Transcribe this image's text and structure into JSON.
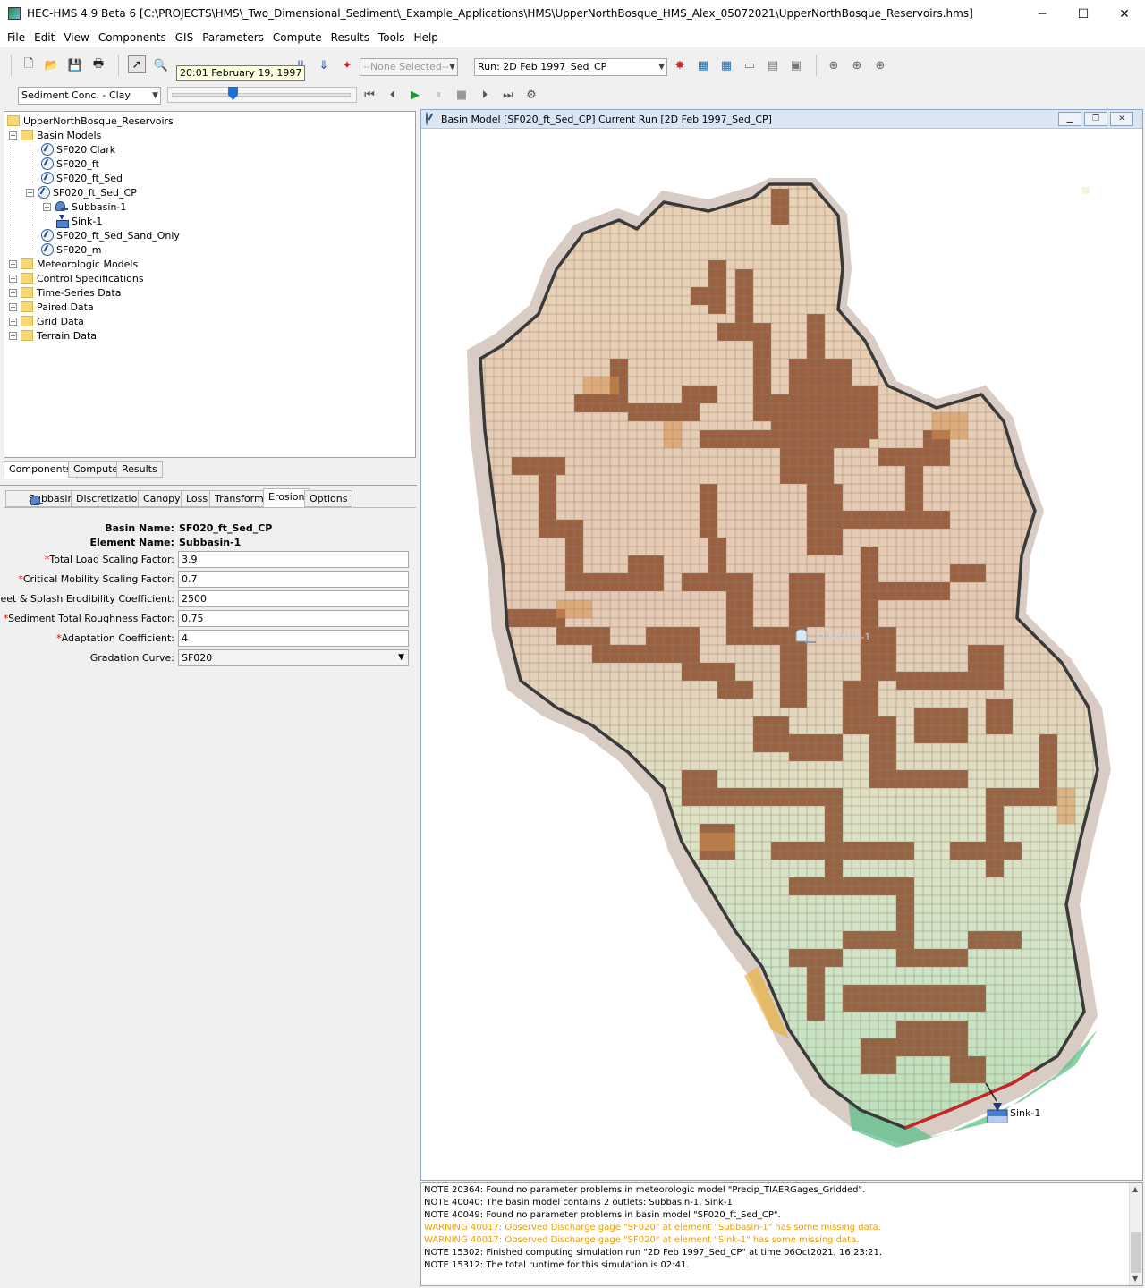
{
  "window": {
    "title": "HEC-HMS 4.9 Beta 6 [C:\\PROJECTS\\HMS\\_Two_Dimensional_Sediment\\_Example_Applications\\HMS\\UpperNorthBosque_HMS_Alex_05072021\\UpperNorthBosque_Reservoirs.hms]",
    "minimize": "─",
    "maximize": "☐",
    "close": "✕"
  },
  "menu": [
    "File",
    "Edit",
    "View",
    "Components",
    "GIS",
    "Parameters",
    "Compute",
    "Results",
    "Tools",
    "Help"
  ],
  "toolbar": {
    "tooltip": "20:01 February 19, 1997",
    "element_selector": "--None Selected--",
    "run_selector": "Run: 2D Feb 1997_Sed_CP",
    "variable_selector": "Sediment Conc. - Clay",
    "animation_position": 0.34
  },
  "tree": {
    "root": "UpperNorthBosque_Reservoirs",
    "basin_models_label": "Basin Models",
    "basins": [
      "SF020 Clark",
      "SF020_ft",
      "SF020_ft_Sed",
      "SF020_ft_Sed_CP"
    ],
    "children": [
      "Subbasin-1",
      "Sink-1"
    ],
    "basins_after": [
      "SF020_ft_Sed_Sand_Only",
      "SF020_m"
    ],
    "folders": [
      "Meteorologic Models",
      "Control Specifications",
      "Time-Series Data",
      "Paired Data",
      "Grid Data",
      "Terrain Data"
    ]
  },
  "bottom_tabs": [
    "Components",
    "Compute",
    "Results"
  ],
  "prop_tabs": [
    "Subbasin",
    "Discretization",
    "Canopy",
    "Loss",
    "Transform",
    "Erosion",
    "Options"
  ],
  "properties": {
    "basin_name_label": "Basin Name:",
    "basin_name": "SF020_ft_Sed_CP",
    "element_name_label": "Element Name:",
    "element_name": "Subbasin-1",
    "fields": [
      {
        "label": "Total Load Scaling Factor:",
        "value": "3.9",
        "required": "*"
      },
      {
        "label": "Critical Mobility Scaling Factor:",
        "value": "0.7",
        "required": "*"
      },
      {
        "label": "Sheet & Splash Erodibility Coefficient:",
        "value": "2500",
        "required": "*"
      },
      {
        "label": "Sediment Total Roughness Factor:",
        "value": "0.75",
        "required": "*"
      },
      {
        "label": "Adaptation Coefficient:",
        "value": "4",
        "required": "*"
      }
    ],
    "gradation_label": "Gradation Curve:",
    "gradation_value": "SF020"
  },
  "map": {
    "title": "Basin Model [SF020_ft_Sed_CP] Current Run [2D Feb 1997_Sed_CP]",
    "subbasin_label": "Subbasin-1",
    "sink_label": "Sink-1"
  },
  "log": [
    {
      "text": "NOTE 20364:  Found no parameter problems in meteorologic model \"Precip_TIAERGages_Gridded\".",
      "level": "note"
    },
    {
      "text": "NOTE 40040:  The basin model contains 2 outlets: Subbasin-1, Sink-1",
      "level": "note"
    },
    {
      "text": "NOTE 40049:  Found no parameter problems in basin model \"SF020_ft_Sed_CP\".",
      "level": "note"
    },
    {
      "text": "WARNING 40017:  Observed Discharge gage \"SF020\" at element \"Subbasin-1\" has some missing data.",
      "level": "warn"
    },
    {
      "text": "WARNING 40017:  Observed Discharge gage \"SF020\" at element \"Sink-1\" has some missing data.",
      "level": "warn"
    },
    {
      "text": "NOTE 15302:  Finished computing simulation run \"2D Feb 1997_Sed_CP\" at time 06Oct2021, 16:23:21.",
      "level": "note"
    },
    {
      "text": "NOTE 15312:  The total runtime for this simulation is 02:41.",
      "level": "note"
    }
  ]
}
